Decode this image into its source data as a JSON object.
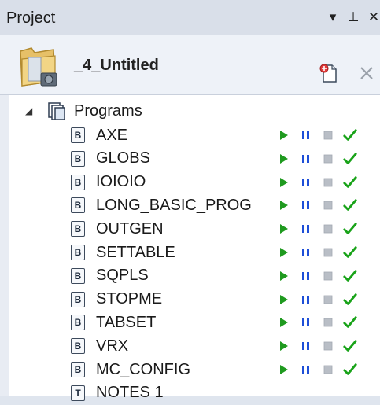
{
  "window": {
    "title": "Project",
    "controls": [
      "▾",
      "⊥",
      "✕"
    ]
  },
  "header": {
    "project_name": "_4_Untitled"
  },
  "tree": {
    "root": {
      "label": "Programs",
      "expanded": true
    },
    "items": [
      {
        "label": "AXE",
        "type": "B",
        "controls": true
      },
      {
        "label": "GLOBS",
        "type": "B",
        "controls": true
      },
      {
        "label": "IOIOIO",
        "type": "B",
        "controls": true
      },
      {
        "label": "LONG_BASIC_PROG",
        "type": "B",
        "controls": true
      },
      {
        "label": "OUTGEN",
        "type": "B",
        "controls": true
      },
      {
        "label": "SETTABLE",
        "type": "B",
        "controls": true
      },
      {
        "label": "SQPLS",
        "type": "B",
        "controls": true
      },
      {
        "label": "STOPME",
        "type": "B",
        "controls": true
      },
      {
        "label": "TABSET",
        "type": "B",
        "controls": true
      },
      {
        "label": "VRX",
        "type": "B",
        "controls": true
      },
      {
        "label": "MC_CONFIG",
        "type": "B",
        "controls": true
      },
      {
        "label": "NOTES 1",
        "type": "T",
        "controls": false
      }
    ]
  },
  "colors": {
    "run": "#1f9a1f",
    "pause": "#1e4fd8",
    "stop": "#b9bec6",
    "check": "#19a319"
  }
}
